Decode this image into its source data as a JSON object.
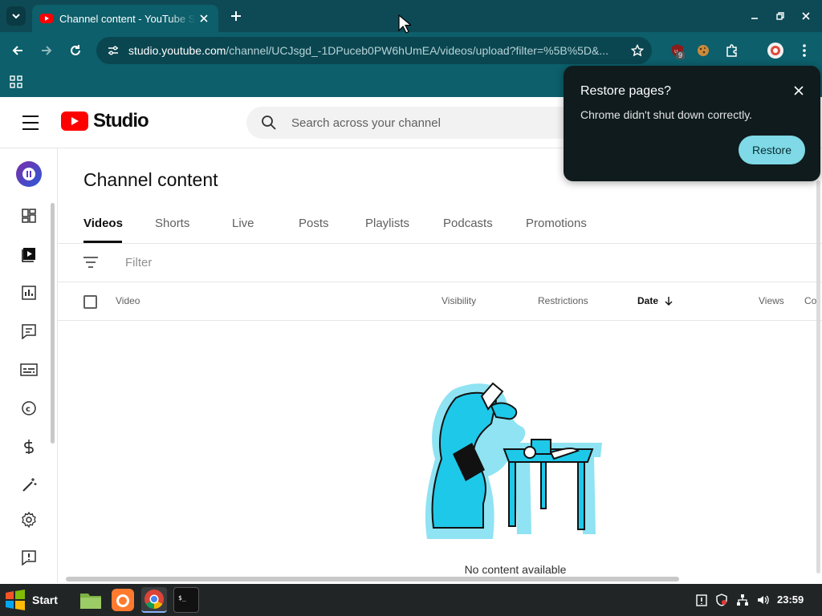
{
  "browser": {
    "tab": {
      "title": "Channel content - YouTube Studio"
    },
    "url": {
      "host": "studio.youtube.com",
      "path": "/channel/UCJsgd_-1DPuceb0PW6hUmEA/videos/upload?filter=%5B%5D&..."
    },
    "extension_badge": "9"
  },
  "studio": {
    "logo_text": "Studio",
    "search_placeholder": "Search across your channel",
    "page_title": "Channel content",
    "tabs": [
      {
        "label": "Videos",
        "active": true
      },
      {
        "label": "Shorts"
      },
      {
        "label": "Live"
      },
      {
        "label": "Posts"
      },
      {
        "label": "Playlists"
      },
      {
        "label": "Podcasts"
      },
      {
        "label": "Promotions"
      }
    ],
    "filter_placeholder": "Filter",
    "columns": {
      "video": "Video",
      "visibility": "Visibility",
      "restrictions": "Restrictions",
      "date": "Date",
      "views": "Views",
      "comments": "Co"
    },
    "empty_message": "No content available"
  },
  "restore_popup": {
    "title": "Restore pages?",
    "message": "Chrome didn't shut down correctly.",
    "button": "Restore"
  },
  "taskbar": {
    "start_label": "Start",
    "clock": "23:59"
  },
  "colors": {
    "chrome_frame": "#0e4a55",
    "chrome_toolbar": "#0c5f6b",
    "youtube_red": "#ff0000",
    "restore_button": "#7fd9e6",
    "illustration_cyan": "#1ec8e8"
  }
}
